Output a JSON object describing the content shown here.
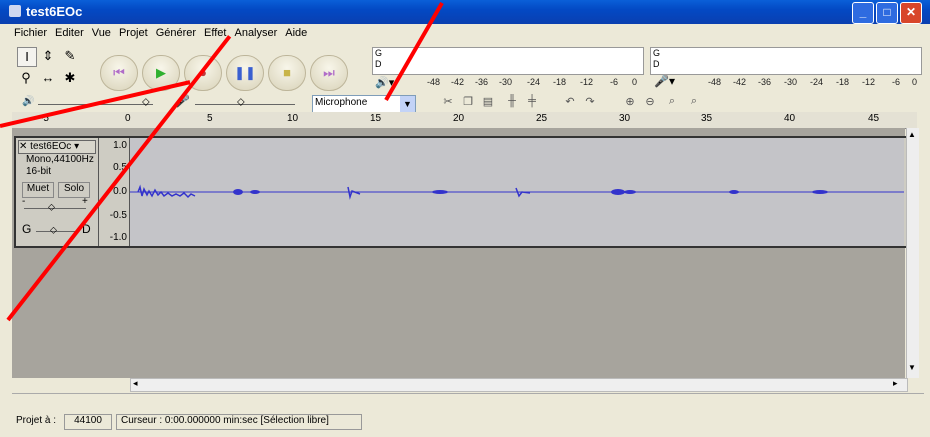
{
  "window": {
    "title": "test6EOc"
  },
  "menu": [
    "Fichier",
    "Editer",
    "Vue",
    "Projet",
    "Générer",
    "Effet",
    "Analyser",
    "Aide"
  ],
  "meters": {
    "left": {
      "g": "G",
      "d": "D"
    },
    "right": {
      "g": "G",
      "d": "D"
    },
    "scale": [
      "-48",
      "-42",
      "-36",
      "-30",
      "-24",
      "-18",
      "-12",
      "-6",
      "0"
    ]
  },
  "input_source": {
    "selected": "Microphone"
  },
  "ruler_ticks": [
    "-5",
    "0",
    "5",
    "10",
    "15",
    "20",
    "25",
    "30",
    "35",
    "40",
    "45"
  ],
  "track": {
    "name": "test6EOc",
    "info1": "Mono,44100Hz",
    "info2": "16-bit",
    "mute": "Muet",
    "solo": "Solo",
    "gain_left": "-",
    "gain_right": "+",
    "pan_left": "G",
    "pan_right": "D",
    "scale": [
      "1.0",
      "0.5",
      "0.0",
      "-0.5",
      "-1.0"
    ]
  },
  "status": {
    "project_rate_label": "Projet à :",
    "project_rate": "44100",
    "cursor": "Curseur : 0:00.000000 min:sec  [Sélection libre]"
  },
  "colors": {
    "titlebar": "#0a5fd8",
    "arrows": "#ff0000",
    "waveform": "#3333cc"
  }
}
